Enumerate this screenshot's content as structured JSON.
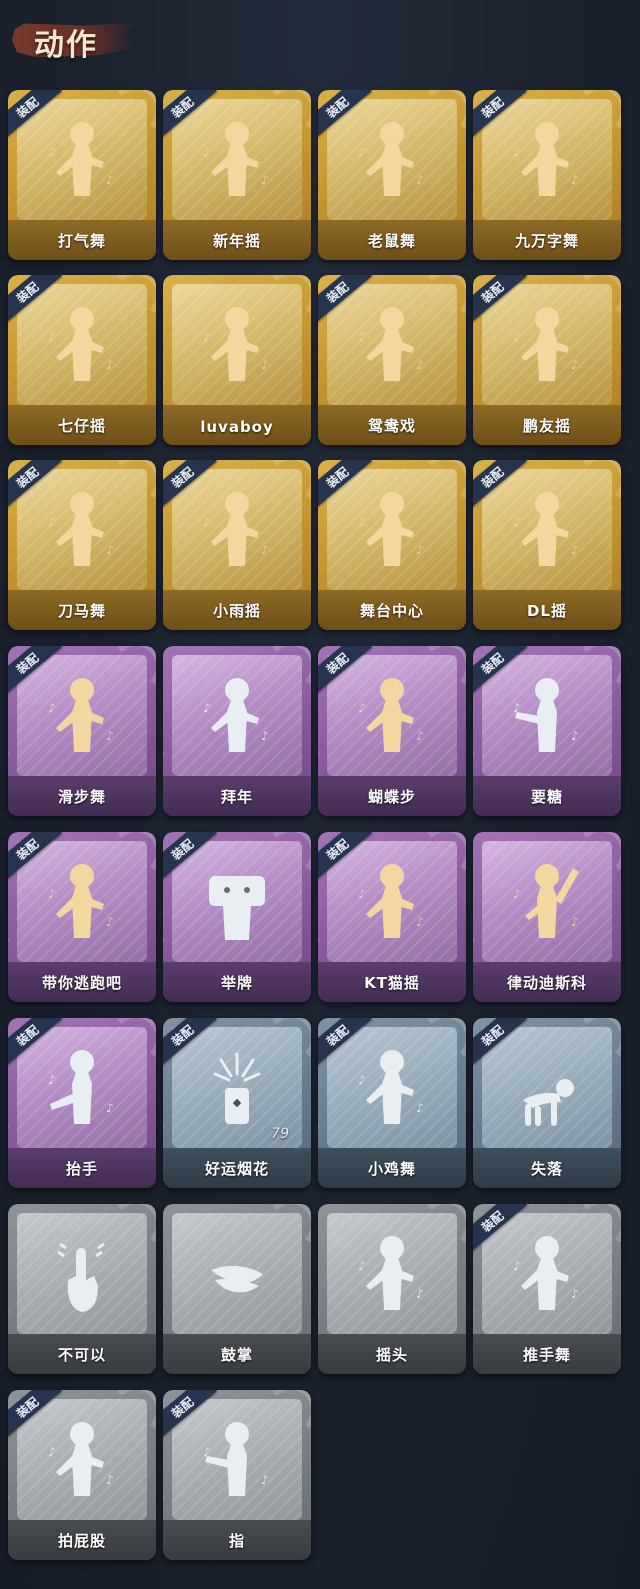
{
  "header": {
    "title": "动作"
  },
  "badge_text": "装配",
  "colors": {
    "background": "#1b2230",
    "gold": "#c89a33",
    "purple": "#8c5ea0",
    "blue": "#6a7f90",
    "grey": "#7b8086",
    "badge": "#26344d",
    "figure_gold": "#f2d7a0",
    "figure_grey": "#e9eef2"
  },
  "items": [
    {
      "label": "打气舞",
      "rarity": "gold",
      "equipped": true,
      "icon": "dance-figure-icon",
      "figure": "gold"
    },
    {
      "label": "新年摇",
      "rarity": "gold",
      "equipped": true,
      "icon": "dance-figure-icon",
      "figure": "gold"
    },
    {
      "label": "老鼠舞",
      "rarity": "gold",
      "equipped": true,
      "icon": "dance-figure-icon",
      "figure": "gold"
    },
    {
      "label": "九万字舞",
      "rarity": "gold",
      "equipped": true,
      "icon": "dance-figure-icon",
      "figure": "gold"
    },
    {
      "label": "七仔摇",
      "rarity": "gold",
      "equipped": true,
      "icon": "dance-figure-icon",
      "figure": "gold"
    },
    {
      "label": "luvaboy",
      "rarity": "gold",
      "equipped": false,
      "icon": "dance-figure-icon",
      "figure": "gold"
    },
    {
      "label": "鸳鸯戏",
      "rarity": "gold",
      "equipped": true,
      "icon": "dance-figure-icon",
      "figure": "gold"
    },
    {
      "label": "鹏友摇",
      "rarity": "gold",
      "equipped": true,
      "icon": "dance-figure-icon",
      "figure": "gold"
    },
    {
      "label": "刀马舞",
      "rarity": "gold",
      "equipped": true,
      "icon": "dance-figure-icon",
      "figure": "gold"
    },
    {
      "label": "小雨摇",
      "rarity": "gold",
      "equipped": true,
      "icon": "dance-figure-icon",
      "figure": "gold"
    },
    {
      "label": "舞台中心",
      "rarity": "gold",
      "equipped": true,
      "icon": "dance-figure-icon",
      "figure": "gold"
    },
    {
      "label": "DL摇",
      "rarity": "gold",
      "equipped": true,
      "icon": "dance-figure-icon",
      "figure": "gold"
    },
    {
      "label": "滑步舞",
      "rarity": "purple",
      "equipped": true,
      "icon": "dance-figure-icon",
      "figure": "gold"
    },
    {
      "label": "拜年",
      "rarity": "purple",
      "equipped": false,
      "icon": "bow-figure-icon",
      "figure": "grey"
    },
    {
      "label": "蝴蝶步",
      "rarity": "purple",
      "equipped": true,
      "icon": "dance-figure-icon",
      "figure": "gold"
    },
    {
      "label": "要糖",
      "rarity": "purple",
      "equipped": true,
      "icon": "reach-figure-icon",
      "figure": "grey"
    },
    {
      "label": "带你逃跑吧",
      "rarity": "purple",
      "equipped": true,
      "icon": "dance-figure-icon",
      "figure": "gold"
    },
    {
      "label": "举牌",
      "rarity": "purple",
      "equipped": true,
      "icon": "sign-figure-icon",
      "figure": "grey"
    },
    {
      "label": "KT猫摇",
      "rarity": "purple",
      "equipped": true,
      "icon": "dance-figure-icon",
      "figure": "gold"
    },
    {
      "label": "律动迪斯科",
      "rarity": "purple",
      "equipped": false,
      "icon": "disco-figure-icon",
      "figure": "gold"
    },
    {
      "label": "抬手",
      "rarity": "purple",
      "equipped": true,
      "icon": "raise-hand-icon",
      "figure": "grey"
    },
    {
      "label": "好运烟花",
      "rarity": "blue",
      "equipped": true,
      "icon": "firework-icon",
      "figure": "grey",
      "count": "79"
    },
    {
      "label": "小鸡舞",
      "rarity": "blue",
      "equipped": true,
      "icon": "chicken-dance-icon",
      "figure": "grey"
    },
    {
      "label": "失落",
      "rarity": "blue",
      "equipped": true,
      "icon": "crawl-figure-icon",
      "figure": "grey"
    },
    {
      "label": "不可以",
      "rarity": "grey",
      "equipped": false,
      "icon": "finger-wag-icon",
      "figure": "grey"
    },
    {
      "label": "鼓掌",
      "rarity": "grey",
      "equipped": false,
      "icon": "clap-icon",
      "figure": "grey"
    },
    {
      "label": "摇头",
      "rarity": "grey",
      "equipped": false,
      "icon": "shake-head-icon",
      "figure": "grey"
    },
    {
      "label": "推手舞",
      "rarity": "grey",
      "equipped": true,
      "icon": "push-hands-icon",
      "figure": "grey"
    },
    {
      "label": "拍屁股",
      "rarity": "grey",
      "equipped": true,
      "icon": "spank-figure-icon",
      "figure": "grey"
    },
    {
      "label": "指",
      "rarity": "grey",
      "equipped": true,
      "icon": "point-hand-icon",
      "figure": "grey"
    }
  ]
}
